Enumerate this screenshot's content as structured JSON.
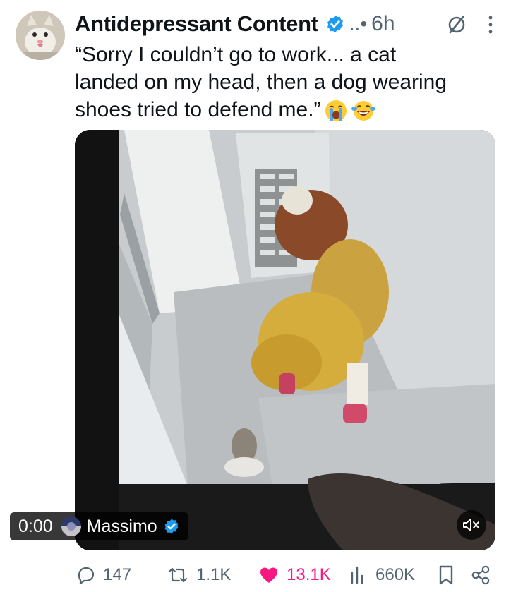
{
  "post": {
    "author_name": "Antidepressant Content",
    "handle_dots": "..•",
    "time": "6h",
    "text_lines": [
      "“Sorry I couldn’t go to work... a cat",
      "landed on my head, then a dog wearing",
      "shoes tried to defend me.”"
    ]
  },
  "media": {
    "timer": "0:00",
    "source_name": "Massimo",
    "mute_icon": "volume-muted-icon"
  },
  "actions": {
    "replies": "147",
    "reposts": "1.1K",
    "likes": "13.1K",
    "views": "660K"
  },
  "colors": {
    "verified": "#1d9bf0",
    "like": "#f91880",
    "muted_text": "#536471"
  }
}
